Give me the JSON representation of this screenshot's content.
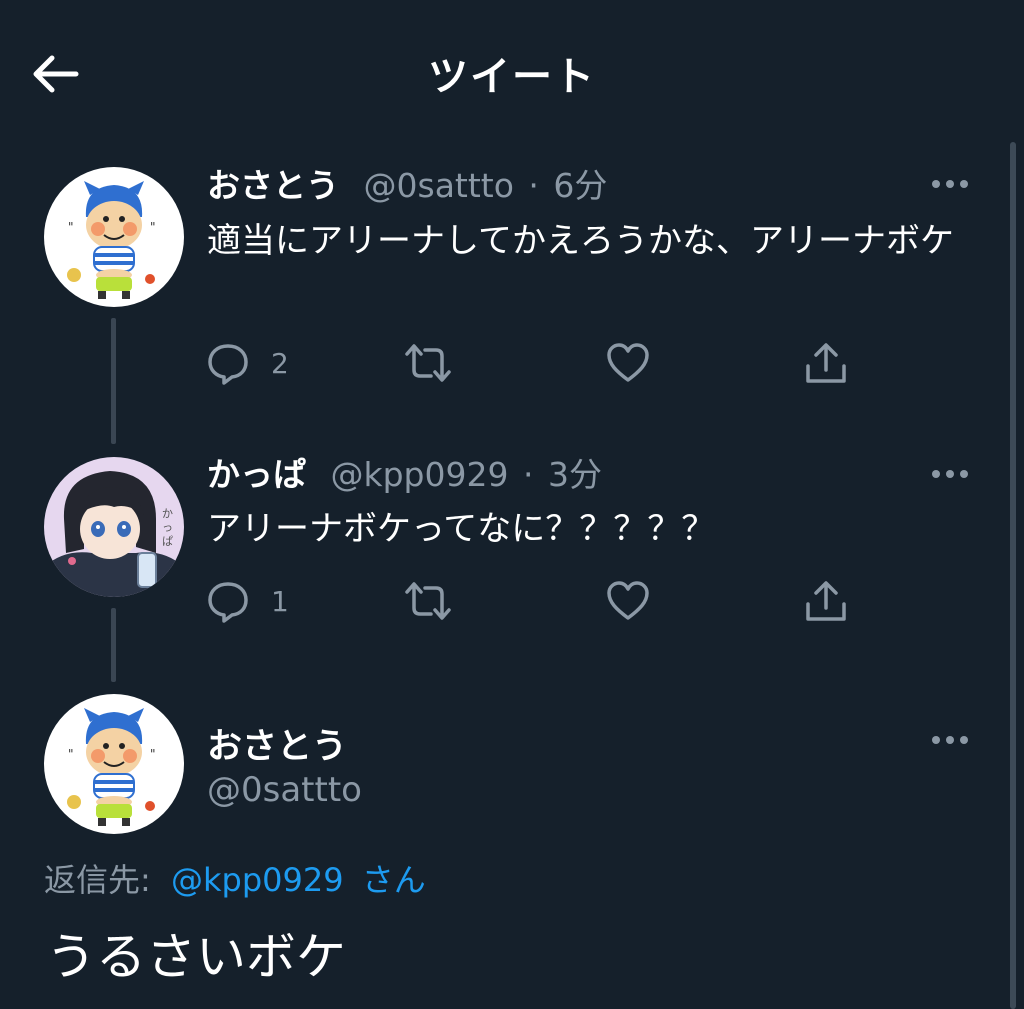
{
  "header": {
    "title": "ツイート",
    "back_icon": "arrow-left-icon"
  },
  "colors": {
    "background": "#15202b",
    "secondary_text": "#8b98a5",
    "link": "#1d9bf0",
    "thread_line": "#3a4653"
  },
  "tweets": [
    {
      "display_name": "おさとう",
      "handle": "@0sattto",
      "separator": "·",
      "time": "6分",
      "text": "適当にアリーナしてかえろうかな、アリーナボケ",
      "reply_count": "2",
      "icons": [
        "reply-icon",
        "retweet-icon",
        "like-icon",
        "share-icon",
        "more-icon"
      ]
    },
    {
      "display_name": "かっぱ",
      "handle": "@kpp0929",
      "separator": "·",
      "time": "3分",
      "text": "アリーナボケってなに？？？？？",
      "reply_count": "1",
      "icons": [
        "reply-icon",
        "retweet-icon",
        "like-icon",
        "share-icon",
        "more-icon"
      ]
    }
  ],
  "main_tweet": {
    "display_name": "おさとう",
    "handle": "@0sattto",
    "reply_label": "返信先:",
    "reply_mention": "@kpp0929",
    "reply_suffix": "さん",
    "text": "うるさいボケ"
  }
}
